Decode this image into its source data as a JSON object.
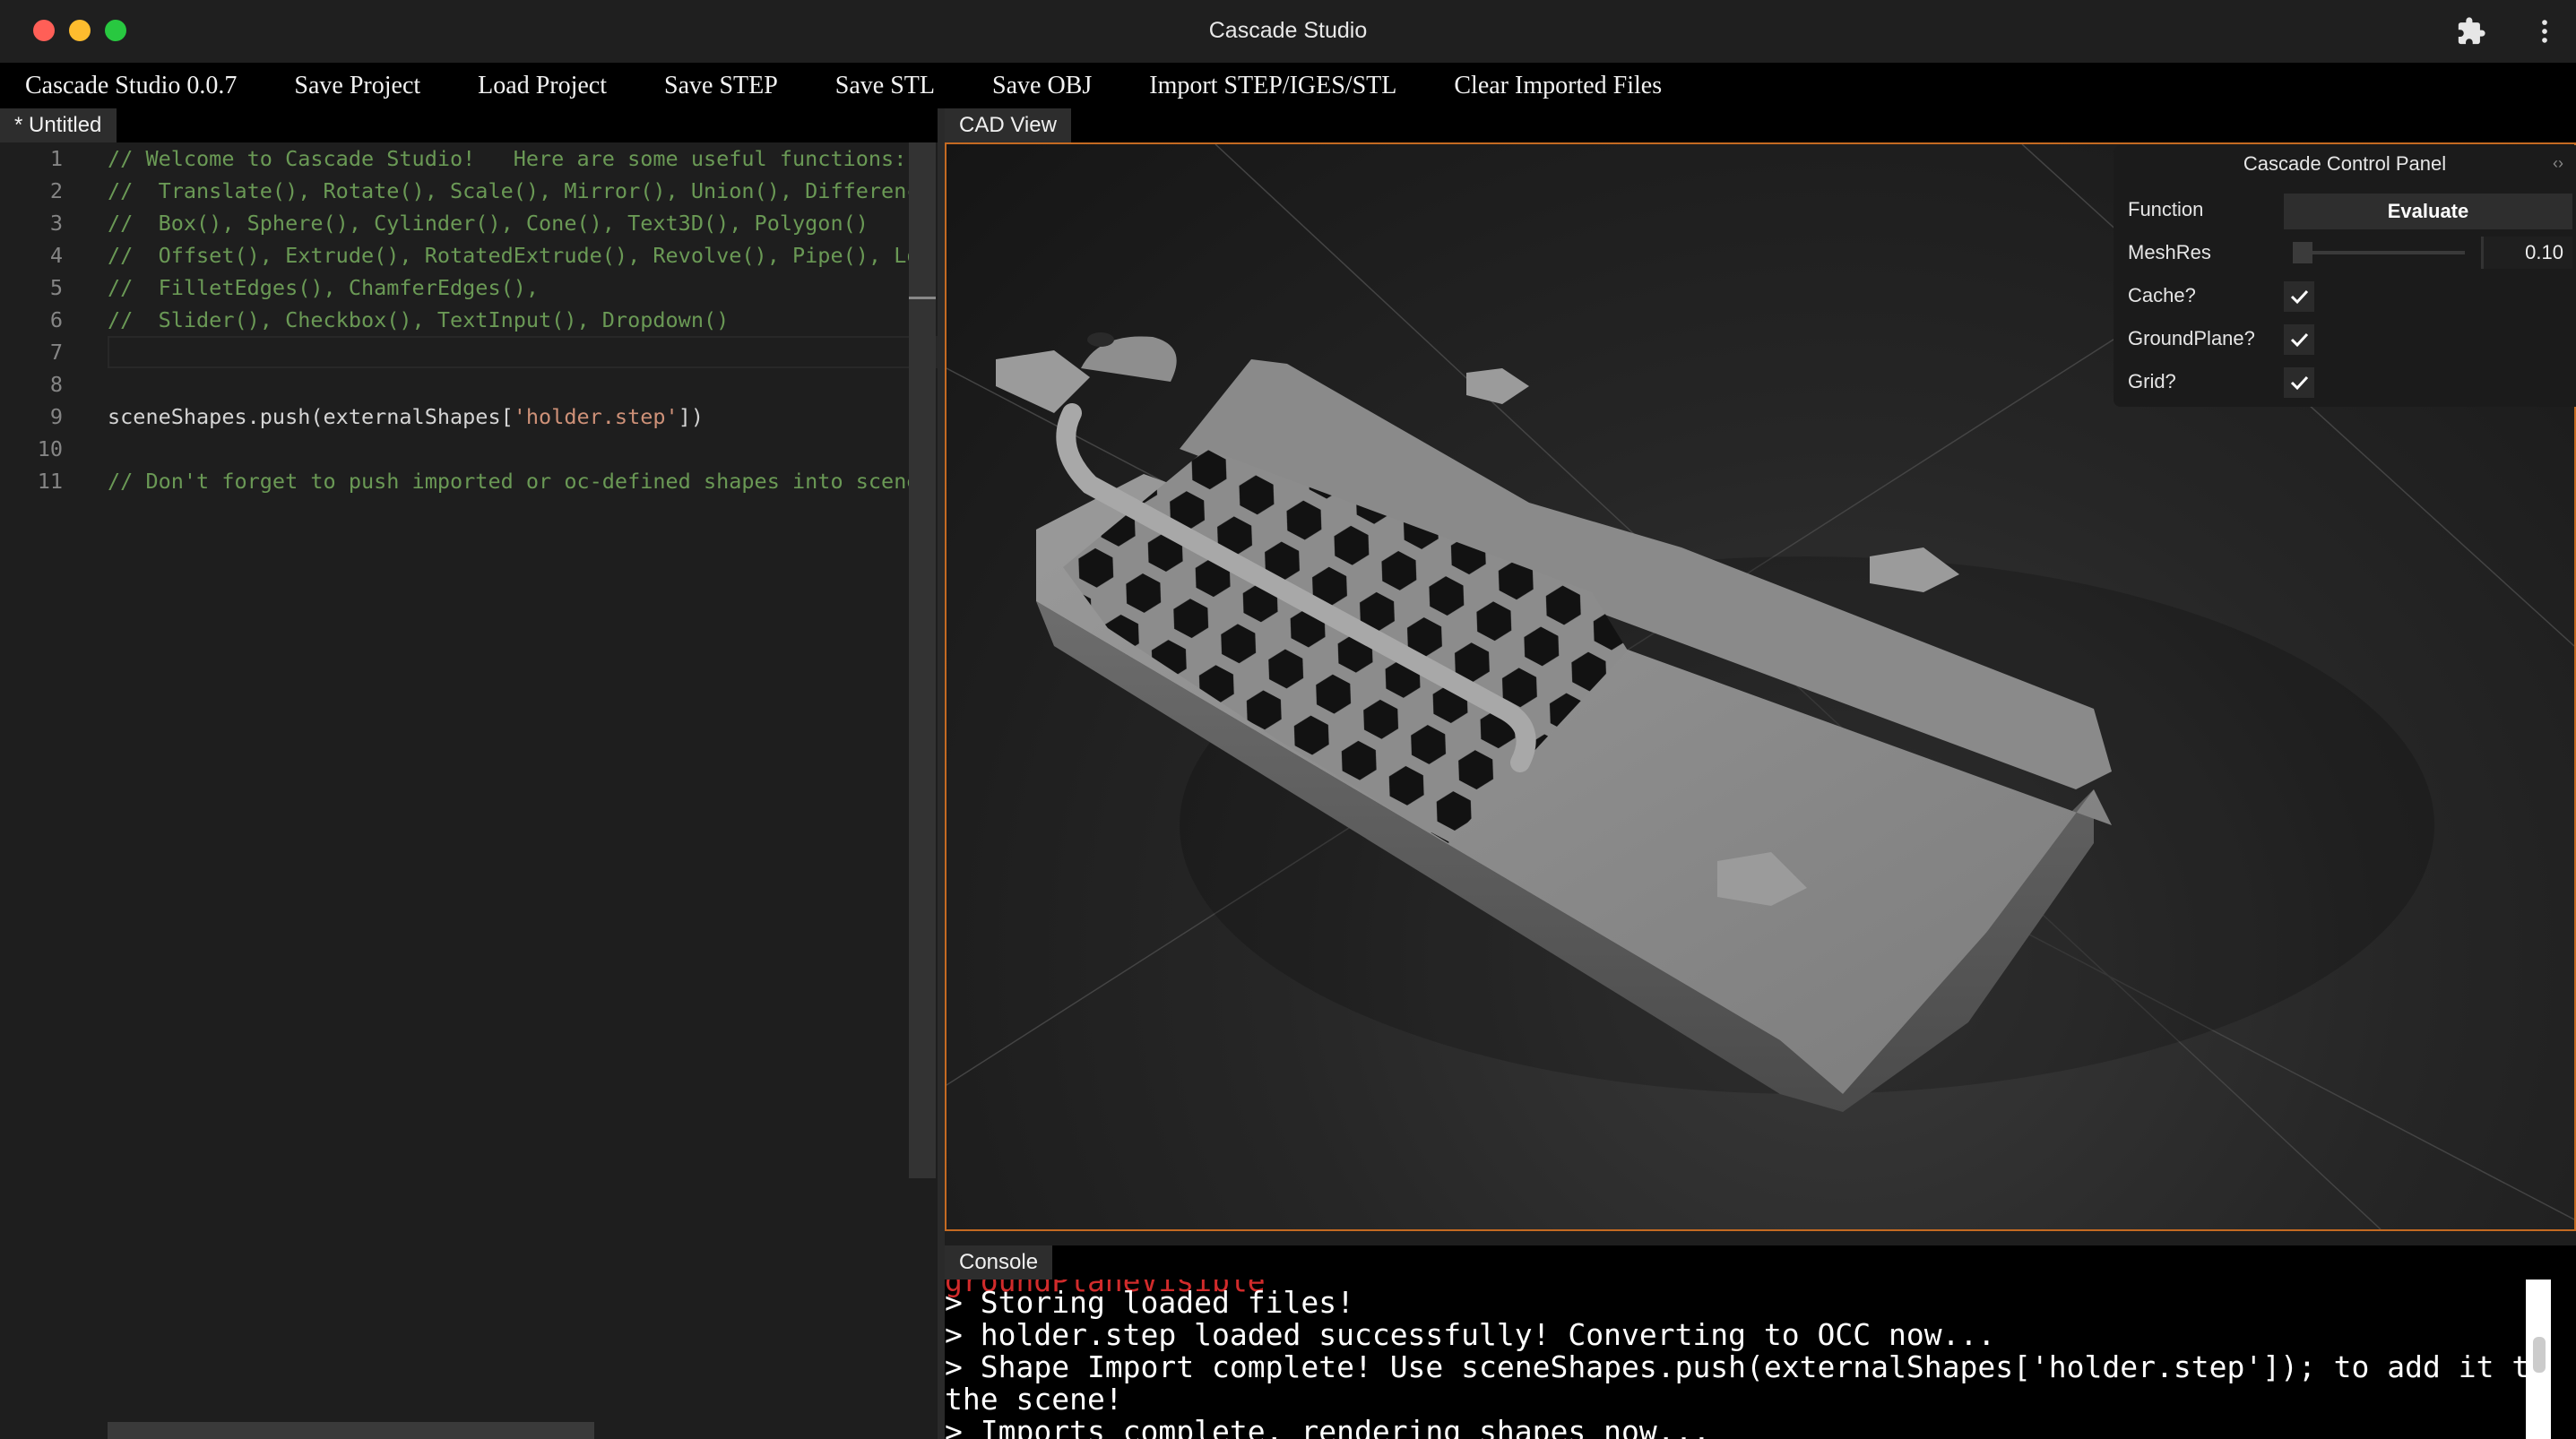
{
  "window": {
    "title": "Cascade Studio",
    "traffic_lights": [
      "#ff5f57",
      "#febc2e",
      "#28c840"
    ],
    "icons": [
      "extensions-puzzle-icon",
      "more-vertical-icon"
    ]
  },
  "menu": {
    "items": [
      "Cascade Studio 0.0.7",
      "Save Project",
      "Load Project",
      "Save STEP",
      "Save STL",
      "Save OBJ",
      "Import STEP/IGES/STL",
      "Clear Imported Files"
    ]
  },
  "editor": {
    "tab_label": "* Untitled",
    "lines": [
      {
        "n": "1",
        "code": "// Welcome to Cascade Studio!   Here are some useful functions:",
        "kind": "comment"
      },
      {
        "n": "2",
        "code": "//  Translate(), Rotate(), Scale(), Mirror(), Union(), Differenc",
        "kind": "comment"
      },
      {
        "n": "3",
        "code": "//  Box(), Sphere(), Cylinder(), Cone(), Text3D(), Polygon()",
        "kind": "comment"
      },
      {
        "n": "4",
        "code": "//  Offset(), Extrude(), RotatedExtrude(), Revolve(), Pipe(), Lo",
        "kind": "comment"
      },
      {
        "n": "5",
        "code": "//  FilletEdges(), ChamferEdges(),",
        "kind": "comment"
      },
      {
        "n": "6",
        "code": "//  Slider(), Checkbox(), TextInput(), Dropdown()",
        "kind": "comment"
      },
      {
        "n": "7",
        "code": "",
        "kind": "plain"
      },
      {
        "n": "8",
        "code": "",
        "kind": "plain"
      },
      {
        "n": "9",
        "code_before": "sceneShapes.push(externalShapes[",
        "code_string": "'holder.step'",
        "code_after": "])",
        "kind": "mixed"
      },
      {
        "n": "10",
        "code": "",
        "kind": "plain"
      },
      {
        "n": "11",
        "code": "// Don't forget to push imported or oc-defined shapes into scene",
        "kind": "comment"
      }
    ]
  },
  "cad_view": {
    "tab_label": "CAD View",
    "accent_border": "#c46a22"
  },
  "control_panel": {
    "title": "Cascade Control Panel",
    "collapse_glyph": "‹›",
    "rows": {
      "function_label": "Function",
      "evaluate_label": "Evaluate",
      "meshres_label": "MeshRes",
      "meshres_value": "0.10",
      "cache_label": "Cache?",
      "groundplane_label": "GroundPlane?",
      "grid_label": "Grid?"
    },
    "checked": {
      "cache": true,
      "groundplane": true,
      "grid": true
    },
    "check_glyph": "✓"
  },
  "console": {
    "tab_label": "Console",
    "partial_top": "groundPlaneVisible",
    "lines": [
      "> Storing loaded files!",
      "> holder.step loaded successfully! Converting to OCC now...",
      "> Shape Import complete! Use sceneShapes.push(externalShapes['holder.step']); to add it to",
      "the scene!",
      "> Imports complete, rendering shapes now..."
    ]
  }
}
